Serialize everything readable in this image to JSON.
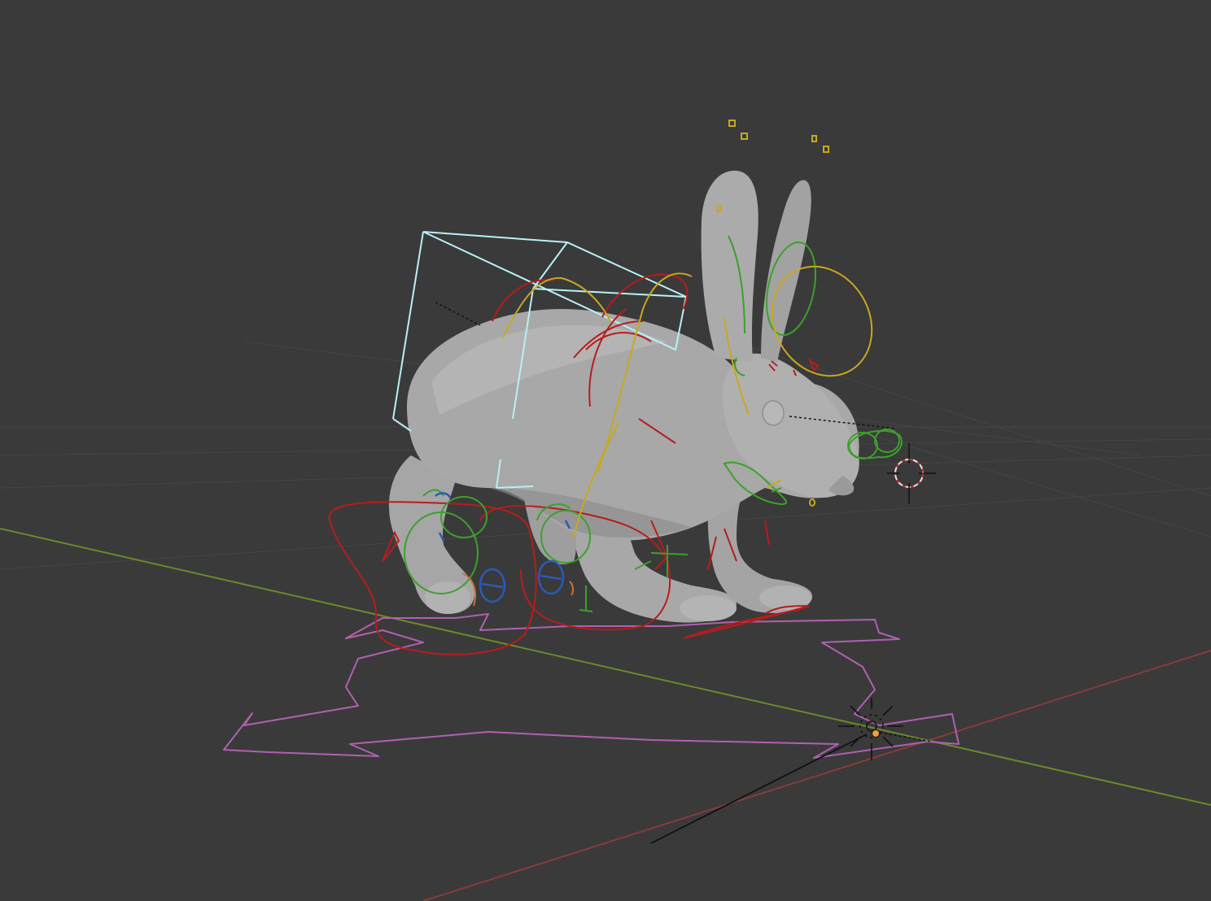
{
  "viewport": {
    "background": "#3a3a3a",
    "grid_color": "#454545",
    "axis_x_color": "#8a3a3a",
    "axis_y_color": "#6a8a2a"
  },
  "mesh": {
    "name": "rabbit",
    "body_color": "#a8a8a8",
    "shade_color": "#8c8c8c",
    "highlight_color": "#c4c4c4"
  },
  "rig": {
    "root_control_color": "#b060b0",
    "ik_control_color": "#b81c1c",
    "fk_control_color": "#3da02a",
    "aux_control_color": "#c8a820",
    "pole_control_color": "#2a5ab8",
    "cage_color": "#b8f0f8",
    "origin_color": "#f0a040"
  },
  "icons": {
    "cursor": "3d-cursor-icon",
    "light": "light-icon",
    "camera_target": "eye-target-icon"
  }
}
